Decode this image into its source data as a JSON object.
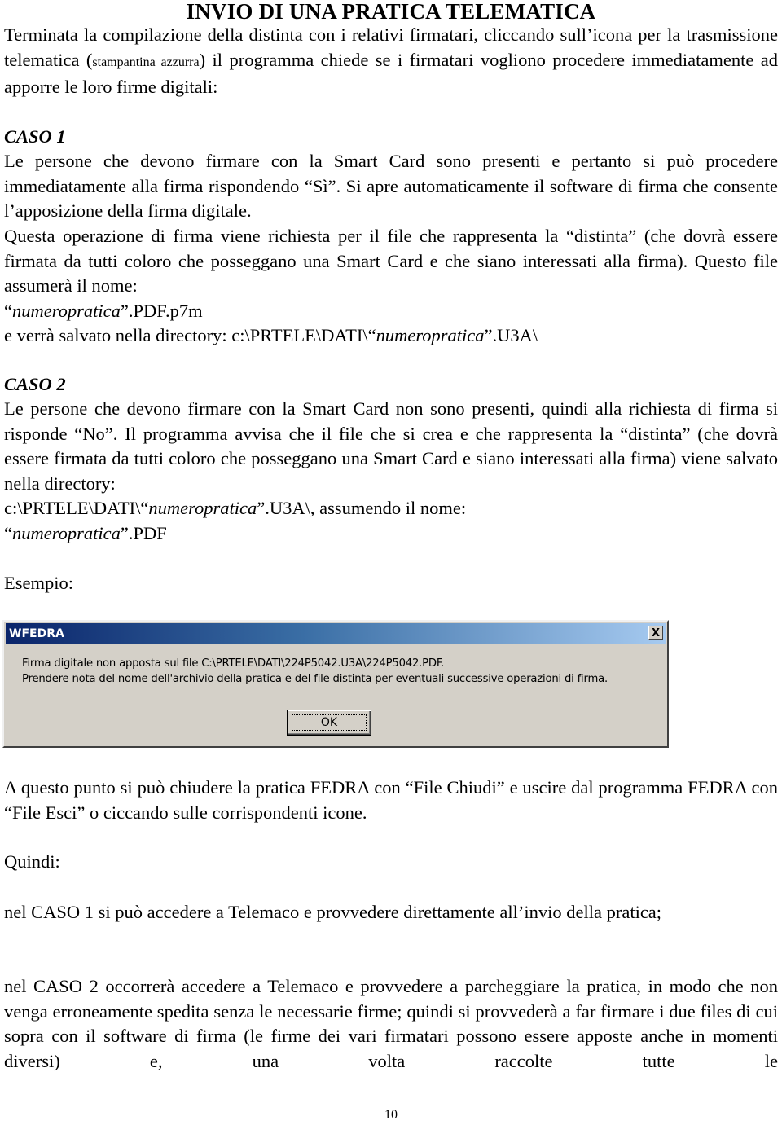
{
  "document": {
    "title": "INVIO DI UNA PRATICA TELEMATICA",
    "intro": {
      "part1": "Terminata la compilazione della distinta con i relativi firmatari, cliccando sull’icona per la trasmissione telematica (",
      "small": "stampantina azzurra",
      "part2": ") il programma chiede se i firmatari vogliono procedere immediatamente ad apporre le loro firme digitali:"
    },
    "caso1": {
      "heading": "CASO 1",
      "para1": "Le persone che devono firmare con la Smart Card sono presenti e pertanto si può procedere immediatamente alla firma rispondendo “Sì”. Si apre automaticamente il software di firma che consente l’apposizione della firma digitale.",
      "para2": "Questa operazione di firma viene richiesta per il file che rappresenta la “distinta” (che dovrà essere firmata da tutti coloro che posseggano una Smart Card e che siano interessati alla firma). Questo file assumerà il nome:",
      "filename_open": "“",
      "filename_italic": "numeropratica",
      "filename_close": "”.PDF.p7m",
      "dir_prefix": "e verrà salvato nella directory: c:\\PRTELE\\DATI\\“",
      "dir_italic": "numeropratica",
      "dir_suffix": "”.U3A\\"
    },
    "caso2": {
      "heading": "CASO 2",
      "para1": "Le persone che devono firmare con la Smart Card non sono presenti, quindi alla richiesta di firma si risponde “No”. Il programma avvisa che il file che si crea e che rappresenta la “distinta” (che dovrà essere firmata da tutti coloro che posseggano una Smart Card e siano interessati alla firma) viene salvato nella directory:",
      "dir_prefix": "c:\\PRTELE\\DATI\\“",
      "dir_italic": "numeropratica",
      "dir_suffix": "”.U3A\\, assumendo il nome:",
      "filename_open": "“",
      "filename_italic": "numeropratica",
      "filename_close": "”.PDF"
    },
    "example_label": "Esempio:",
    "dialog": {
      "title": "WFEDRA",
      "close_glyph": "X",
      "line1": "Firma digitale non apposta sul file C:\\PRTELE\\DATI\\224P5042.U3A\\224P5042.PDF.",
      "line2": "Prendere nota del nome dell'archivio della pratica e del file distinta per eventuali successive operazioni di firma.",
      "ok_label": "OK"
    },
    "closing": "A questo punto si può chiudere la pratica FEDRA con “File Chiudi” e uscire dal programma FEDRA con “File Esci” o ciccando sulle corrispondenti icone.",
    "quindi": "Quindi:",
    "caso1_summary": "nel CASO 1 si può accedere a Telemaco e provvedere direttamente all’invio della pratica;",
    "caso2_summary": "nel CASO 2 occorrerà accedere a Telemaco e provvedere a parcheggiare la pratica, in modo che non venga erroneamente spedita senza le necessarie firme; quindi si provvederà a far firmare i due files di cui sopra con il software di firma (le firme dei vari firmatari possono essere apposte anche in momenti diversi) e, una volta raccolte tutte le",
    "page_number": "10"
  }
}
